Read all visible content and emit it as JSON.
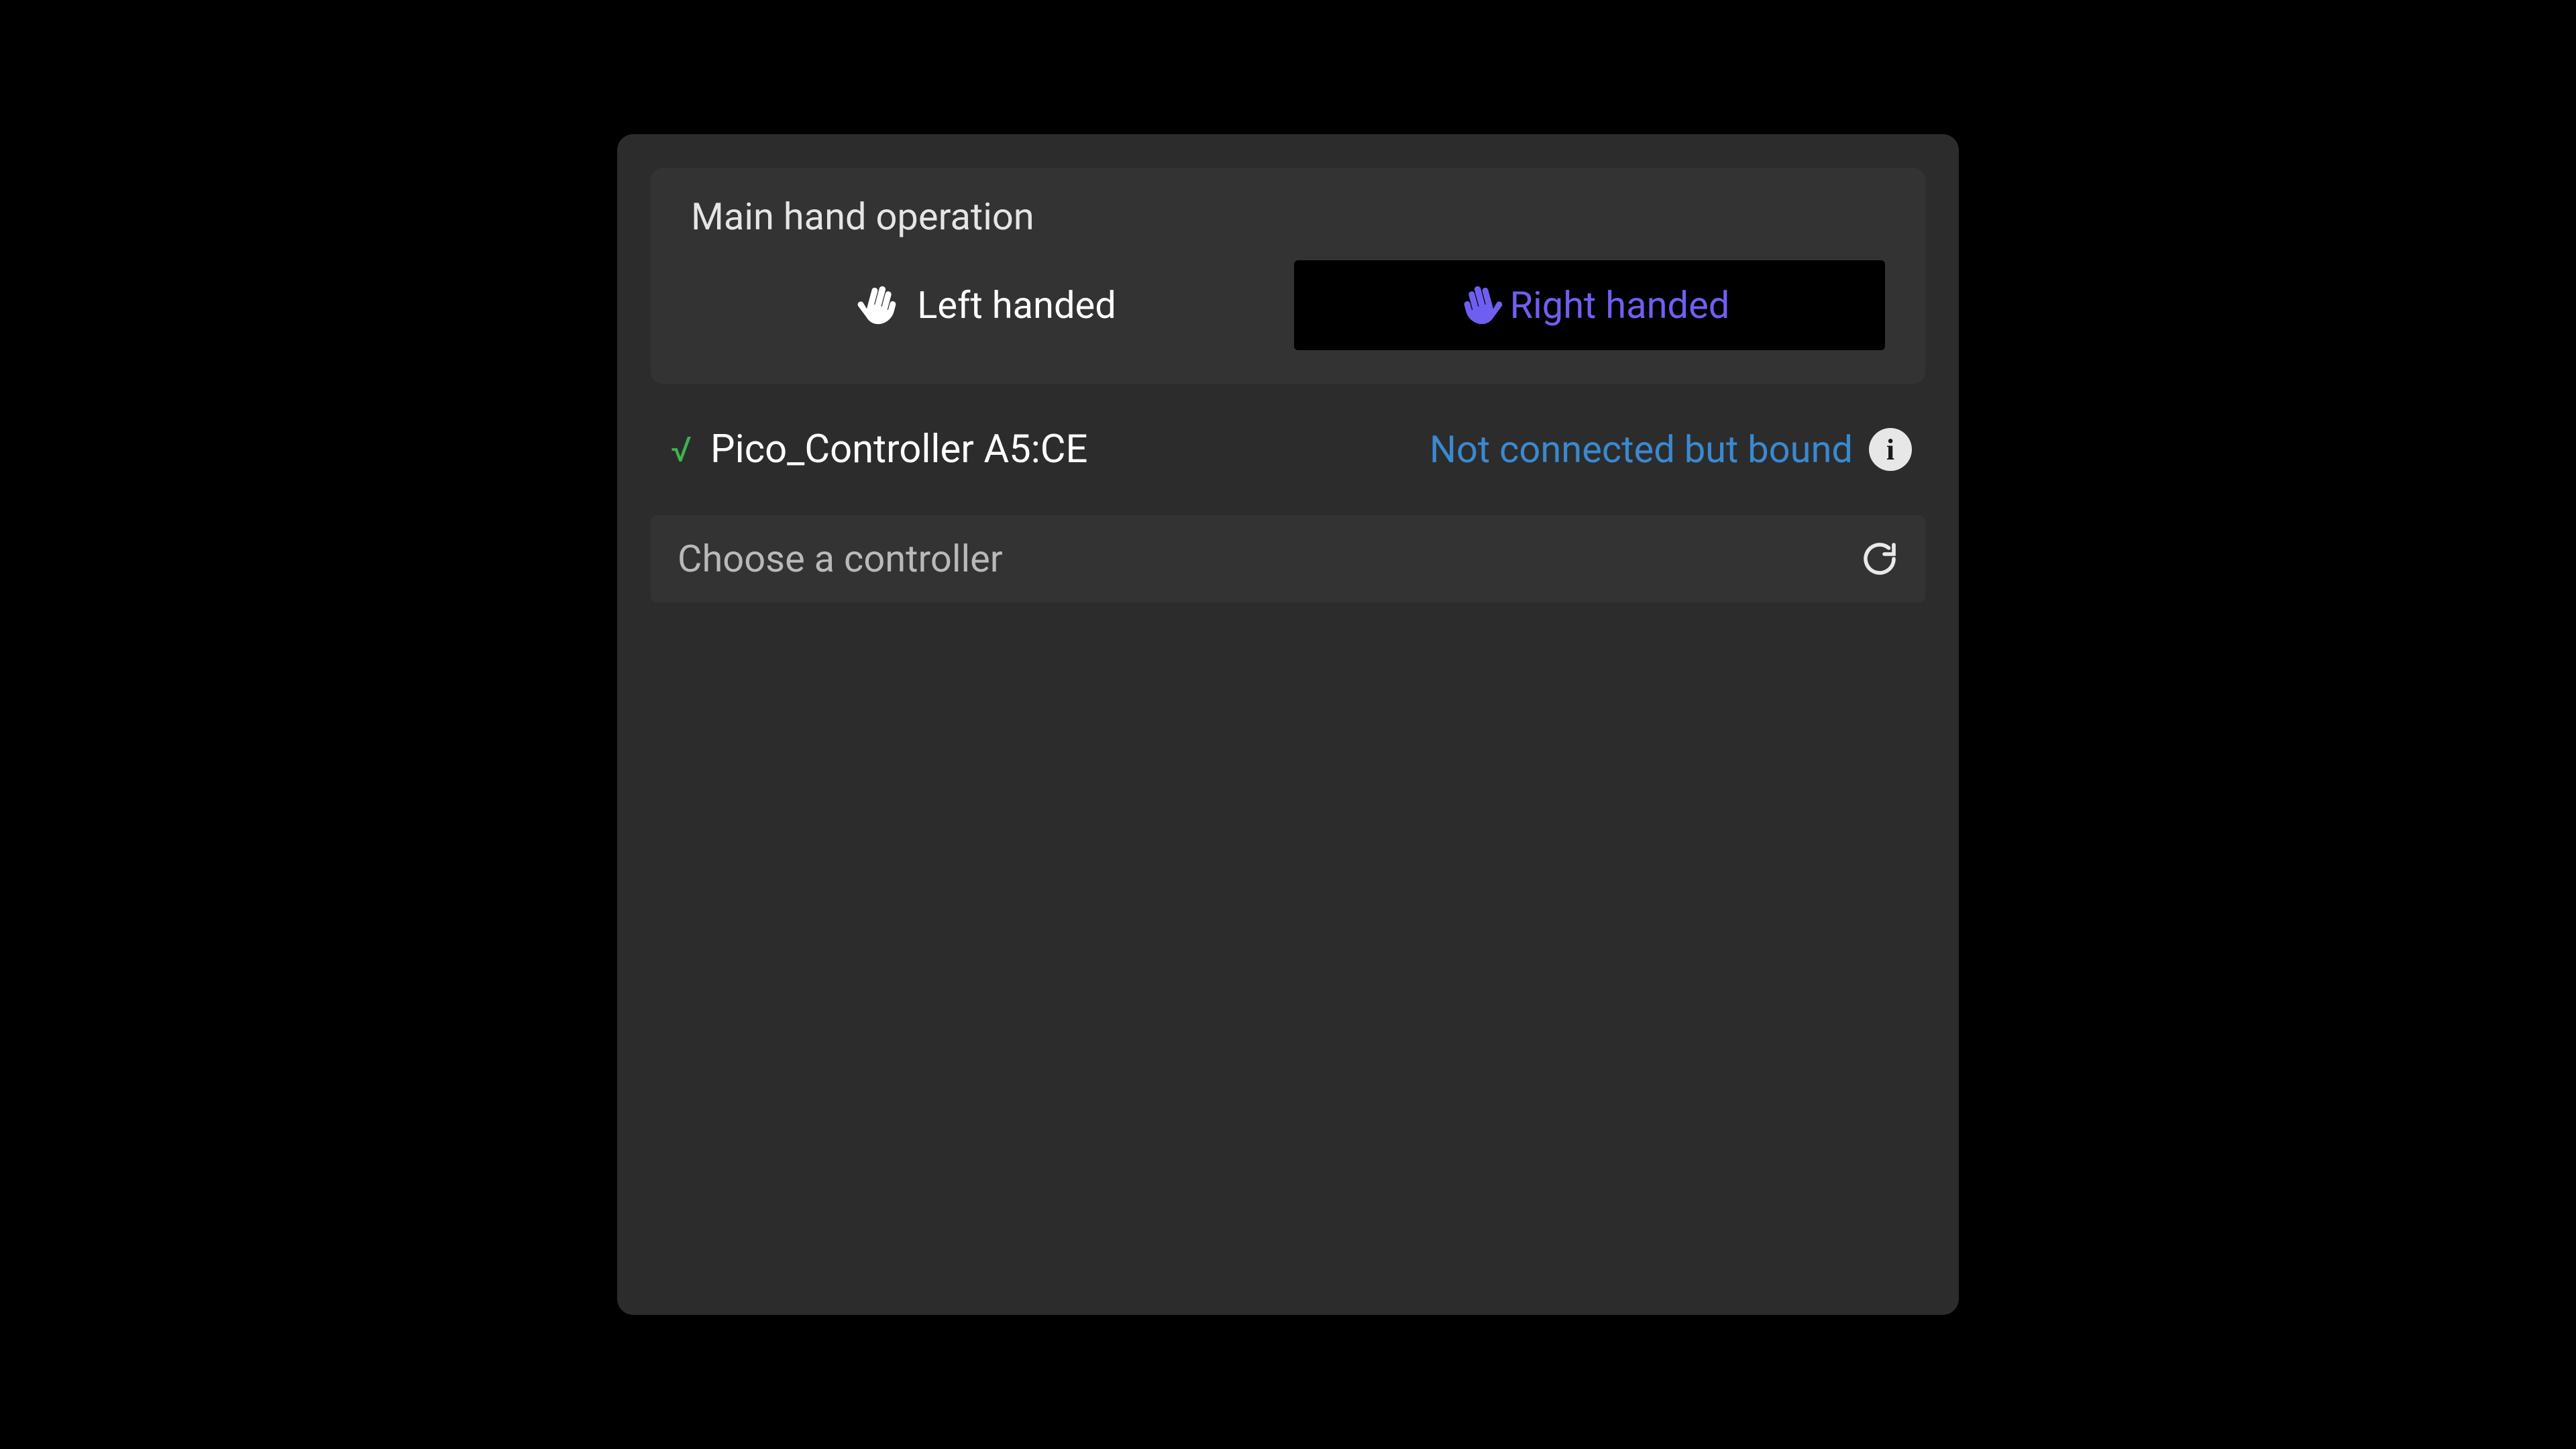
{
  "hand_operation": {
    "title": "Main hand operation",
    "left_label": "Left handed",
    "right_label": "Right handed",
    "selected": "right"
  },
  "device": {
    "check": "√",
    "name": "Pico_Controller A5:CE",
    "status": "Not connected but bound"
  },
  "choose": {
    "label": "Choose a controller"
  },
  "colors": {
    "accent": "#6f5ff0",
    "status_link": "#3a89d1",
    "success": "#3fb34f"
  }
}
